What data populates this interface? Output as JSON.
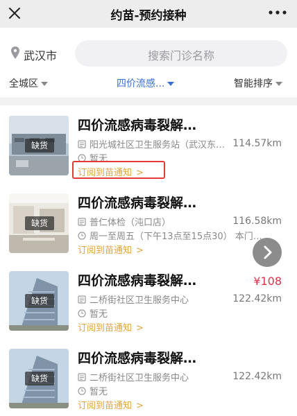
{
  "header": {
    "title": "约苗-预约接种"
  },
  "search": {
    "city": "武汉市",
    "placeholder": "搜索门诊名称"
  },
  "filters": [
    {
      "label": "全城区"
    },
    {
      "label": "四价流感..."
    },
    {
      "label": "智能排序"
    }
  ],
  "cards": [
    {
      "name": "四价流感病毒裂解…",
      "badge": "缺货",
      "clinic": "阳光城社区卫生服务站（武汉东…",
      "hours": "暂无",
      "distance": "114.57km",
      "notify": "订阅到苗通知"
    },
    {
      "name": "四价流感病毒裂解…",
      "badge": "缺货",
      "clinic": "普仁体检（沌口店）",
      "hours": "周一至周五（下午13点至15点30） 本门…",
      "distance": "116.58km",
      "notify": "订阅到苗通知"
    },
    {
      "name": "四价流感病毒裂解…",
      "badge": "缺货",
      "clinic": "二桥街社区卫生服务中心",
      "hours": "暂无",
      "distance": "122.42km",
      "price": "¥108",
      "notify": "订阅到苗通知"
    },
    {
      "name": "四价流感病毒裂解…",
      "badge": "缺货",
      "clinic": "二桥街社区卫生服务中心",
      "hours": "暂无",
      "distance": "122.42km",
      "notify": "订阅到苗通知"
    }
  ],
  "colors": {
    "accent": "#3a6fd1",
    "price": "#e0334a",
    "notify": "#e2a53a",
    "highlight": "#e53935"
  },
  "icons": [
    "close-icon",
    "more-icon",
    "location-pin-icon",
    "caret-down-icon",
    "clinic-icon",
    "clock-icon",
    "chevron-right-icon"
  ]
}
